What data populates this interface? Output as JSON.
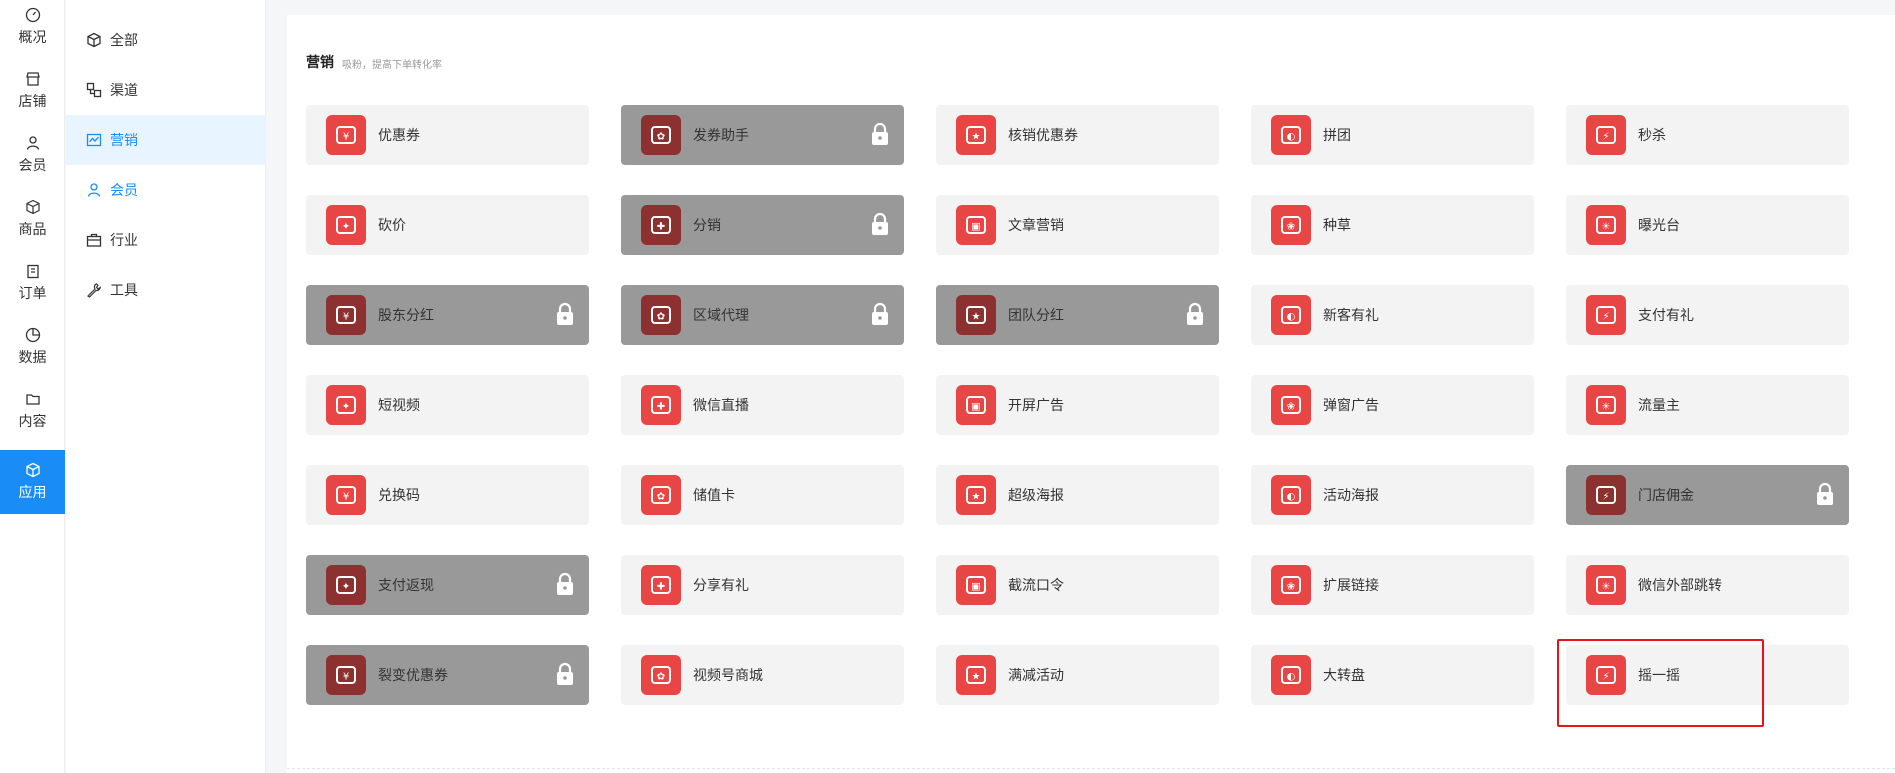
{
  "rail": {
    "items": [
      {
        "label": "概况",
        "icon": "dashboard-icon"
      },
      {
        "label": "店铺",
        "icon": "store-icon"
      },
      {
        "label": "会员",
        "icon": "user-icon"
      },
      {
        "label": "商品",
        "icon": "box-icon"
      },
      {
        "label": "订单",
        "icon": "clipboard-icon"
      },
      {
        "label": "数据",
        "icon": "pie-chart-icon"
      },
      {
        "label": "内容",
        "icon": "folder-icon"
      },
      {
        "label": "应用",
        "icon": "cube-icon"
      }
    ]
  },
  "submenu": {
    "items": [
      {
        "label": "全部",
        "icon": "cube-icon"
      },
      {
        "label": "渠道",
        "icon": "channel-icon"
      },
      {
        "label": "营销",
        "icon": "trend-chart-icon"
      },
      {
        "label": "会员",
        "icon": "user-icon"
      },
      {
        "label": "行业",
        "icon": "briefcase-icon"
      },
      {
        "label": "工具",
        "icon": "wrench-icon"
      }
    ]
  },
  "section": {
    "title": "营销",
    "subtitle": "吸粉，提高下单转化率"
  },
  "apps": [
    {
      "label": "优惠券",
      "locked": false,
      "icon": "coupon-icon"
    },
    {
      "label": "发券助手",
      "locked": true,
      "icon": "coupon-helper-icon"
    },
    {
      "label": "核销优惠券",
      "locked": false,
      "icon": "verify-coupon-icon"
    },
    {
      "label": "拼团",
      "locked": false,
      "icon": "group-buy-icon"
    },
    {
      "label": "秒杀",
      "locked": false,
      "icon": "lightning-icon"
    },
    {
      "label": "砍价",
      "locked": false,
      "icon": "price-tag-icon"
    },
    {
      "label": "分销",
      "locked": true,
      "icon": "money-bag-icon"
    },
    {
      "label": "文章营销",
      "locked": false,
      "icon": "article-icon"
    },
    {
      "label": "种草",
      "locked": false,
      "icon": "sprout-icon"
    },
    {
      "label": "曝光台",
      "locked": false,
      "icon": "sun-icon"
    },
    {
      "label": "股东分红",
      "locked": true,
      "icon": "dividend-icon"
    },
    {
      "label": "区域代理",
      "locked": true,
      "icon": "coin-stack-icon"
    },
    {
      "label": "团队分红",
      "locked": true,
      "icon": "pie-icon"
    },
    {
      "label": "新客有礼",
      "locked": false,
      "icon": "new-badge-icon"
    },
    {
      "label": "支付有礼",
      "locked": false,
      "icon": "gift-icon"
    },
    {
      "label": "短视频",
      "locked": false,
      "icon": "video-camera-icon"
    },
    {
      "label": "微信直播",
      "locked": false,
      "icon": "live-camera-icon"
    },
    {
      "label": "开屏广告",
      "locked": false,
      "icon": "ad-icon"
    },
    {
      "label": "弹窗广告",
      "locked": false,
      "icon": "popup-ad-icon"
    },
    {
      "label": "流量主",
      "locked": false,
      "icon": "drop-icon"
    },
    {
      "label": "兑换码",
      "locked": false,
      "icon": "redeem-code-icon"
    },
    {
      "label": "储值卡",
      "locked": false,
      "icon": "card-icon"
    },
    {
      "label": "超级海报",
      "locked": false,
      "icon": "star-badge-icon"
    },
    {
      "label": "活动海报",
      "locked": false,
      "icon": "timer-icon"
    },
    {
      "label": "门店佣金",
      "locked": true,
      "icon": "commission-icon"
    },
    {
      "label": "支付返现",
      "locked": true,
      "icon": "cashback-icon"
    },
    {
      "label": "分享有礼",
      "locked": false,
      "icon": "share-gift-icon"
    },
    {
      "label": "截流口令",
      "locked": false,
      "icon": "command-icon"
    },
    {
      "label": "扩展链接",
      "locked": false,
      "icon": "link-icon"
    },
    {
      "label": "微信外部跳转",
      "locked": false,
      "icon": "wechat-icon"
    },
    {
      "label": "裂变优惠券",
      "locked": true,
      "icon": "fission-coupon-icon"
    },
    {
      "label": "视频号商城",
      "locked": false,
      "icon": "shop-icon"
    },
    {
      "label": "满减活动",
      "locked": false,
      "icon": "discount-icon"
    },
    {
      "label": "大转盘",
      "locked": false,
      "icon": "wheel-icon"
    },
    {
      "label": "摇一摇",
      "locked": false,
      "icon": "shake-icon"
    }
  ],
  "colors": {
    "accent": "#1a8cf5",
    "icon_red": "#e84545",
    "locked_bg": "#999999",
    "highlight": "#e8121c"
  }
}
